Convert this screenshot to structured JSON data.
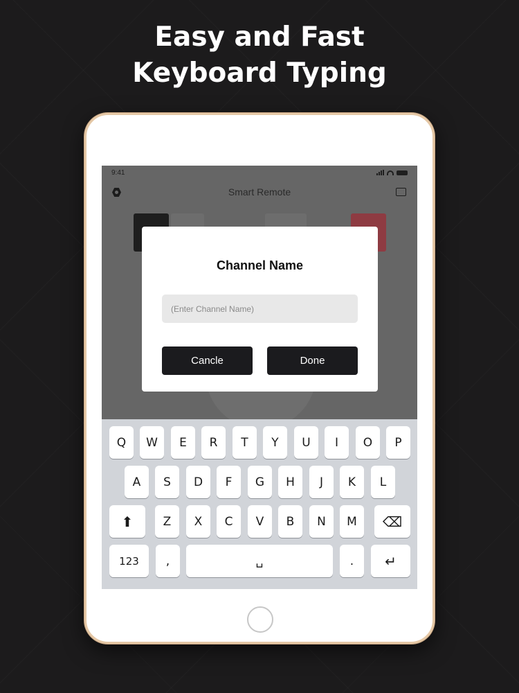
{
  "headline": {
    "line1": "Easy and Fast",
    "line2": "Keyboard Typing"
  },
  "status_bar": {
    "time": "9:41"
  },
  "app": {
    "title": "Smart Remote"
  },
  "dialog": {
    "title": "Channel Name",
    "input_placeholder": "(Enter Channel Name)",
    "input_value": "",
    "cancel_label": "Cancle",
    "done_label": "Done"
  },
  "keyboard": {
    "row1": [
      "Q",
      "W",
      "E",
      "R",
      "T",
      "Y",
      "U",
      "I",
      "O",
      "P"
    ],
    "row2": [
      "A",
      "S",
      "D",
      "F",
      "G",
      "H",
      "J",
      "K",
      "L"
    ],
    "row3": [
      "Z",
      "X",
      "C",
      "V",
      "B",
      "N",
      "M"
    ],
    "shift_glyph": "⬆",
    "backspace_glyph": "⌫",
    "numbers_label": "123",
    "comma": ",",
    "space_glyph": "␣",
    "period": ".",
    "return_glyph": "↵"
  },
  "colors": {
    "background": "#1c1b1c",
    "device_frame": "#e5c8a6",
    "dialog_button": "#1b1b1e",
    "keyboard_bg": "#d1d4d9",
    "accent_red": "#8e3b42"
  }
}
